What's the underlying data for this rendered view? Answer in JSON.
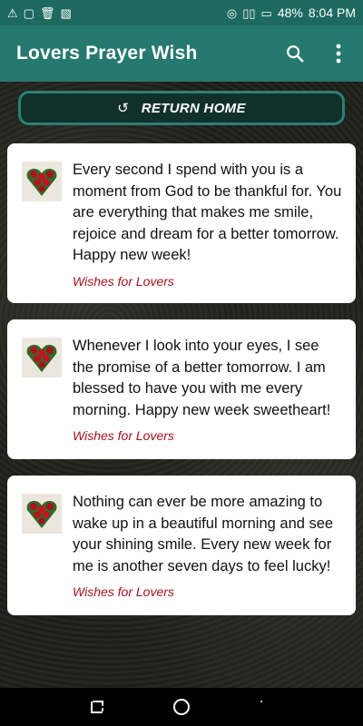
{
  "status_bar": {
    "battery": "48%",
    "time": "8:04 PM"
  },
  "app_bar": {
    "title": "Lovers Prayer Wish",
    "icons": [
      "search-icon",
      "more-vert-icon"
    ]
  },
  "return_button": {
    "label": "RETURN HOME",
    "icon": "refresh-icon"
  },
  "cards": [
    {
      "text": "Every second I spend with you is a moment from God to be thankful for. You are everything that makes me smile, rejoice and dream for a better tomorrow. Happy new week!",
      "category": "Wishes for Lovers"
    },
    {
      "text": "Whenever I look into your eyes, I see the promise of a better tomorrow. I am blessed to have you with me every morning. Happy new week sweetheart!",
      "category": "Wishes for Lovers"
    },
    {
      "text": "Nothing can ever be more amazing to wake up in a beautiful morning and see your shining smile. Every new week for me is another seven days to feel lucky!",
      "category": "Wishes for Lovers"
    }
  ],
  "colors": {
    "status_bar": "#1e6a60",
    "app_bar": "#26796e",
    "category_text": "#a3121c",
    "button_border": "#2e7f74"
  }
}
